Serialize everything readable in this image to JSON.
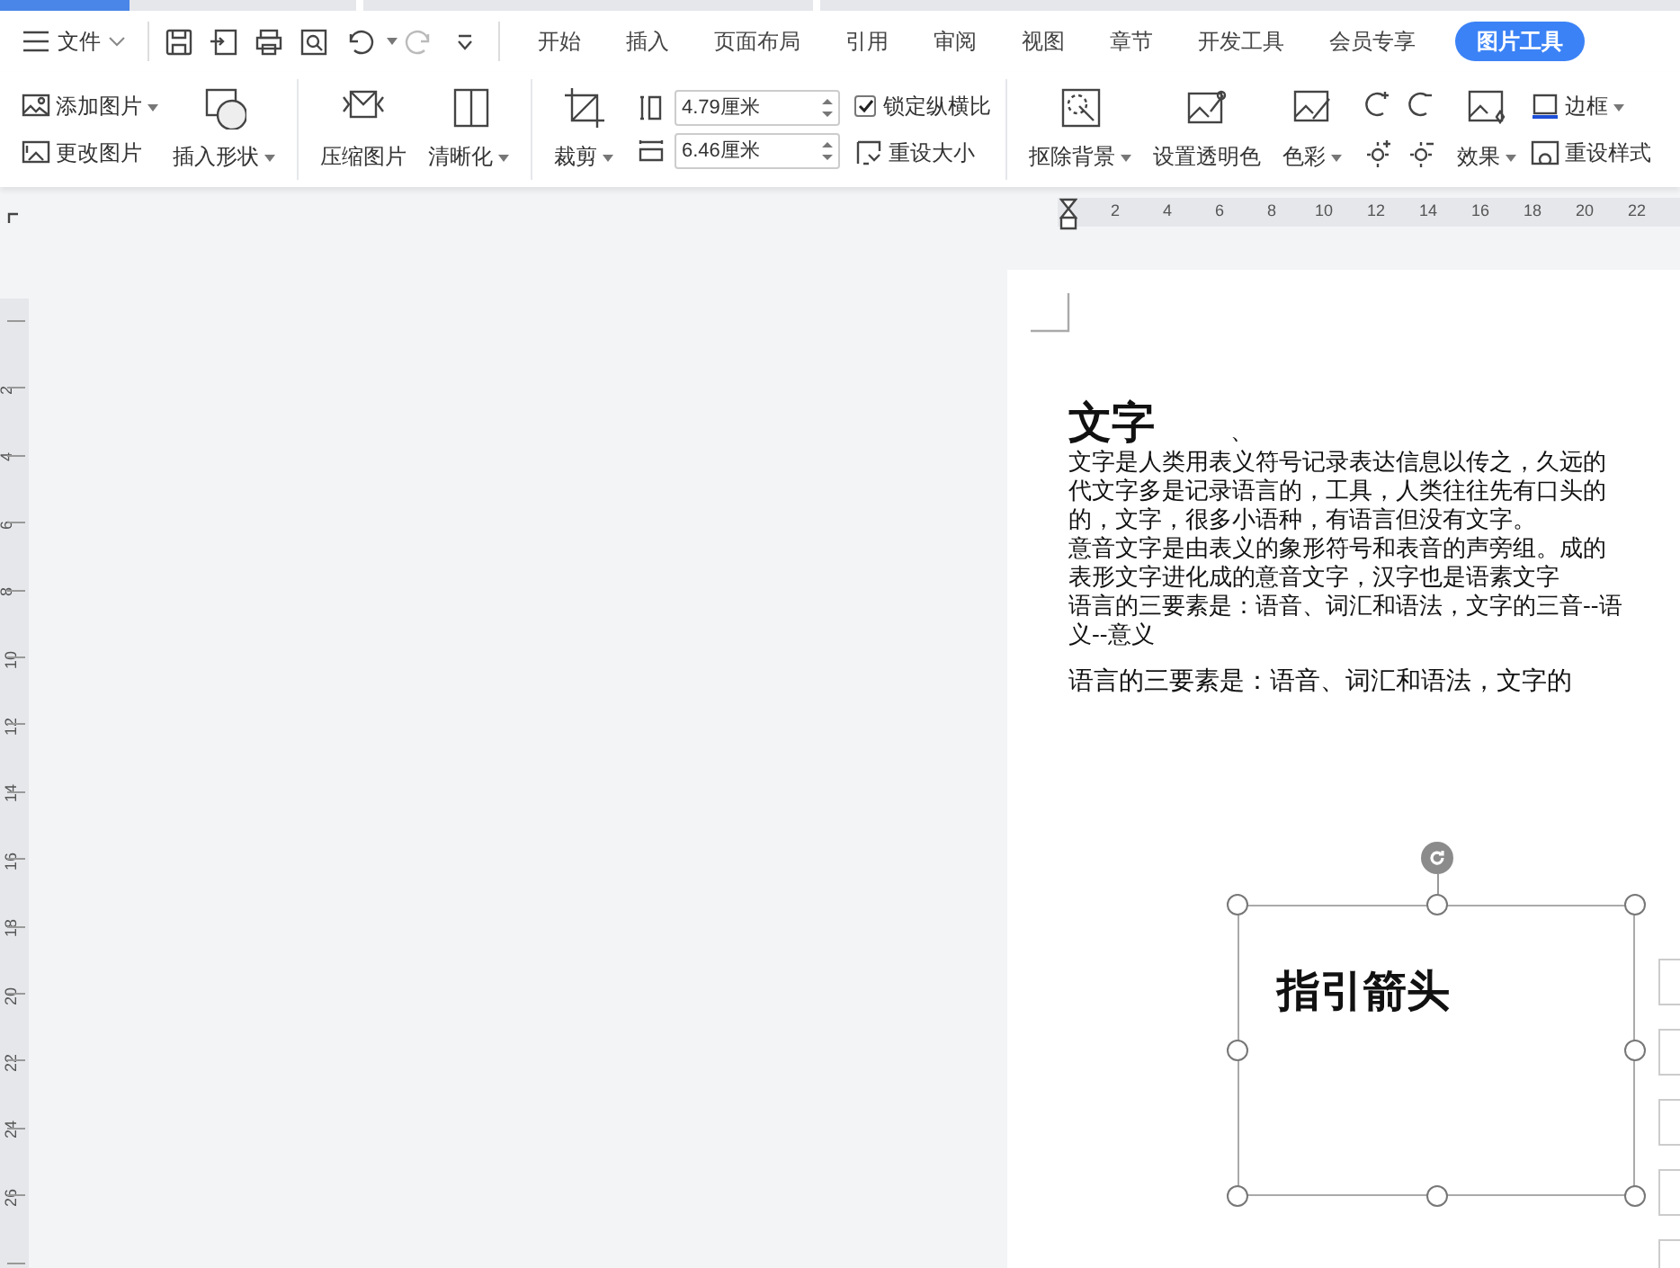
{
  "menu": {
    "file_label": "文件"
  },
  "tabs": [
    {
      "label": "开始",
      "selected": false
    },
    {
      "label": "插入",
      "selected": false
    },
    {
      "label": "页面布局",
      "selected": false
    },
    {
      "label": "引用",
      "selected": false
    },
    {
      "label": "审阅",
      "selected": false
    },
    {
      "label": "视图",
      "selected": false
    },
    {
      "label": "章节",
      "selected": false
    },
    {
      "label": "开发工具",
      "selected": false
    },
    {
      "label": "会员专享",
      "selected": false
    },
    {
      "label": "图片工具",
      "selected": true
    }
  ],
  "ribbon": [
    {
      "kind": "stack",
      "items": [
        {
          "label": "添加图片",
          "dropdown": true
        },
        {
          "label": "更改图片",
          "dropdown": false
        }
      ]
    },
    {
      "kind": "large",
      "label": "插入形状",
      "dropdown": true
    },
    {
      "kind": "divider"
    },
    {
      "kind": "large",
      "label": "压缩图片",
      "dropdown": false
    },
    {
      "kind": "large",
      "label": "清晰化",
      "dropdown": true
    },
    {
      "kind": "divider"
    },
    {
      "kind": "large",
      "label": "裁剪",
      "dropdown": true
    },
    {
      "kind": "size",
      "fields": [
        {
          "value": "4.79厘米"
        },
        {
          "value": "6.46厘米"
        }
      ]
    },
    {
      "kind": "check",
      "label": "锁定纵横比",
      "checked": true,
      "button": "重设大小"
    },
    {
      "kind": "divider"
    },
    {
      "kind": "large",
      "label": "抠除背景",
      "dropdown": true
    },
    {
      "kind": "large",
      "label": "设置透明色",
      "dropdown": false
    },
    {
      "kind": "large",
      "label": "色彩",
      "dropdown": true
    },
    {
      "kind": "icons"
    },
    {
      "kind": "large",
      "label": "效果",
      "dropdown": true
    },
    {
      "kind": "stack",
      "items": [
        {
          "label": "边框",
          "dropdown": true
        },
        {
          "label": "重设样式",
          "dropdown": false
        }
      ]
    }
  ],
  "horizontal_ruler": [
    "2",
    "4",
    "6",
    "8",
    "10",
    "12",
    "14",
    "16",
    "18",
    "20",
    "22"
  ],
  "vertical_ruler": [
    "2",
    "4",
    "6",
    "8",
    "10",
    "12",
    "14",
    "16",
    "18",
    "20",
    "22",
    "24",
    "26"
  ],
  "document": {
    "heading": "文字",
    "heading_mark": "、",
    "lines": [
      "文字是人类用表义符号记录表达信息以传之，久远的",
      "代文字多是记录语言的，工具，人类往往先有口头的",
      "的，文字，很多小语种，有语言但没有文字。",
      "意音文字是由表义的象形符号和表音的声旁组。成的",
      "表形文字进化成的意音文字，汉字也是语素文字",
      "语言的三要素是：语音、词汇和语法，文字的三音--语",
      "义--意义"
    ],
    "last_line": "语言的三要素是：语音、词汇和语法，文字的",
    "text_box": "指引箭头"
  }
}
